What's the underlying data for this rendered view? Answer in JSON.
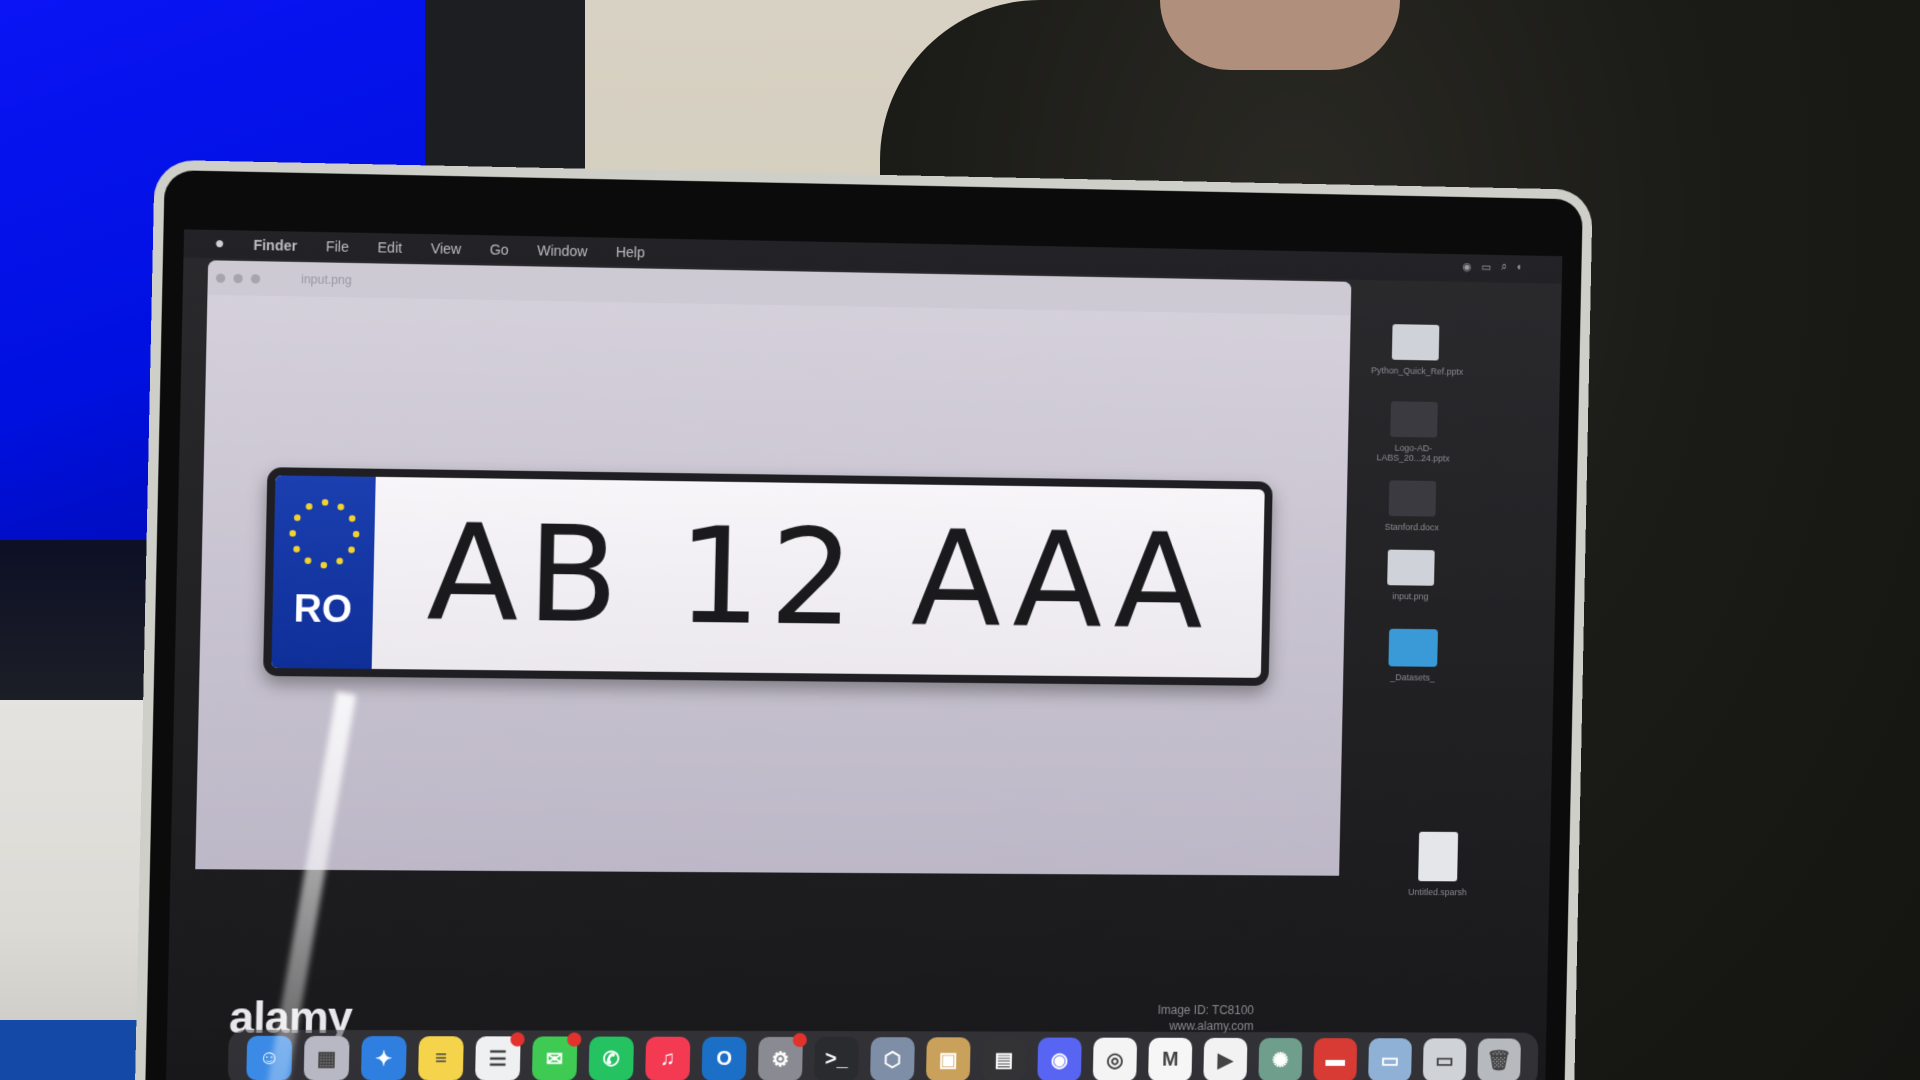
{
  "menubar": {
    "items": [
      "Finder",
      "File",
      "Edit",
      "View",
      "Go",
      "Window",
      "Help"
    ]
  },
  "preview": {
    "filename": "input.png"
  },
  "plate": {
    "country_code": "RO",
    "number": "AB 12 AAA"
  },
  "watermark": {
    "logo": "alamy",
    "image_id": "Image ID: TC8100",
    "site": "www.alamy.com"
  },
  "desktop_icons": [
    "Python_Quick_Ref.pptx",
    "Logo-AD-LABS_20...24.pptx",
    "Stanford.docx",
    "input.png",
    "_Datasets_",
    "Untitled.sparsh"
  ],
  "dock": {
    "apps": [
      {
        "name": "finder",
        "color": "#3b8be6",
        "glyph": "☺"
      },
      {
        "name": "launchpad",
        "color": "#b8b8c4",
        "glyph": "▦"
      },
      {
        "name": "safari",
        "color": "#2e7fe0",
        "glyph": "✦"
      },
      {
        "name": "notes",
        "color": "#f5d34a",
        "glyph": "≡"
      },
      {
        "name": "reminders",
        "color": "#eef0f2",
        "glyph": "☰",
        "badge": true
      },
      {
        "name": "messages",
        "color": "#3fcb53",
        "glyph": "✉",
        "badge": true
      },
      {
        "name": "whatsapp",
        "color": "#25c262",
        "glyph": "✆"
      },
      {
        "name": "music",
        "color": "#f43a52",
        "glyph": "♫"
      },
      {
        "name": "outlook",
        "color": "#1c6fc7",
        "glyph": "O"
      },
      {
        "name": "settings",
        "color": "#8a8a92",
        "glyph": "⚙",
        "badge": true
      },
      {
        "name": "terminal",
        "color": "#2a2b2e",
        "glyph": ">_"
      },
      {
        "name": "xcode",
        "color": "#7e8ea6",
        "glyph": "⬡"
      },
      {
        "name": "archive",
        "color": "#caa15a",
        "glyph": "▣"
      },
      {
        "name": "calculator",
        "color": "#333336",
        "glyph": "▤"
      },
      {
        "name": "discord",
        "color": "#5865f2",
        "glyph": "◉"
      },
      {
        "name": "chrome",
        "color": "#f4f4f4",
        "glyph": "◎"
      },
      {
        "name": "gmail",
        "color": "#f6f6f6",
        "glyph": "M"
      },
      {
        "name": "youtube",
        "color": "#f2f2f2",
        "glyph": "▶"
      },
      {
        "name": "chatgpt",
        "color": "#6f9e8c",
        "glyph": "✺"
      },
      {
        "name": "app-red",
        "color": "#d83a34",
        "glyph": "▬"
      },
      {
        "name": "preview",
        "color": "#8fb1d6",
        "glyph": "▭"
      },
      {
        "name": "downloads",
        "color": "#cfd3d8",
        "glyph": "▭"
      },
      {
        "name": "trash",
        "color": "#b6babf",
        "glyph": "🗑"
      }
    ]
  }
}
